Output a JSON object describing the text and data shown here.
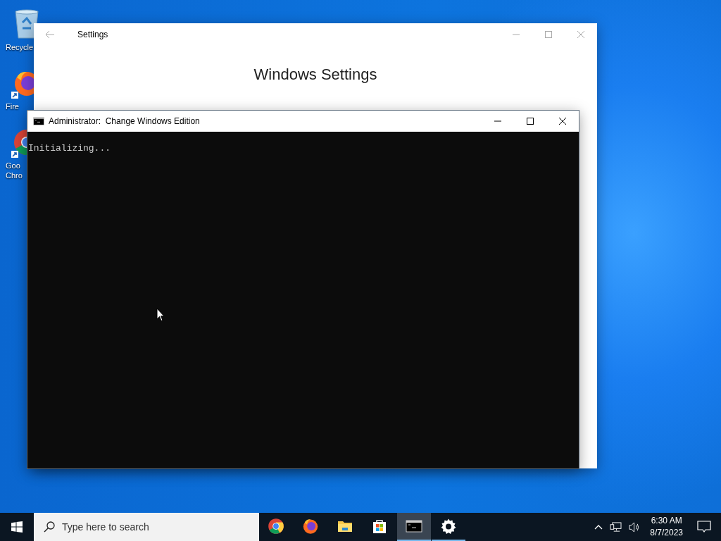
{
  "desktop": {
    "icons": [
      {
        "kind": "recycle-bin",
        "label_lines": [
          "Recycle"
        ],
        "shortcut": false
      },
      {
        "kind": "firefox",
        "label_lines": [
          "Fire"
        ],
        "shortcut": true
      },
      {
        "kind": "chrome",
        "label_lines": [
          "Goo",
          "Chro"
        ],
        "shortcut": true
      }
    ]
  },
  "settings_window": {
    "title": "Settings",
    "heading": "Windows Settings"
  },
  "console_window": {
    "title": "Administrator:  Change Windows Edition",
    "output": [
      "Initializing..."
    ]
  },
  "taskbar": {
    "search": {
      "placeholder": "Type here to search"
    },
    "apps": [
      {
        "kind": "chrome",
        "open": false,
        "selected": false
      },
      {
        "kind": "firefox",
        "open": false,
        "selected": false
      },
      {
        "kind": "explorer",
        "open": false,
        "selected": false
      },
      {
        "kind": "store",
        "open": false,
        "selected": false
      },
      {
        "kind": "console",
        "open": true,
        "selected": true
      },
      {
        "kind": "settings",
        "open": true,
        "selected": false
      }
    ],
    "clock": {
      "time": "6:30 AM",
      "date": "8/7/2023"
    }
  }
}
